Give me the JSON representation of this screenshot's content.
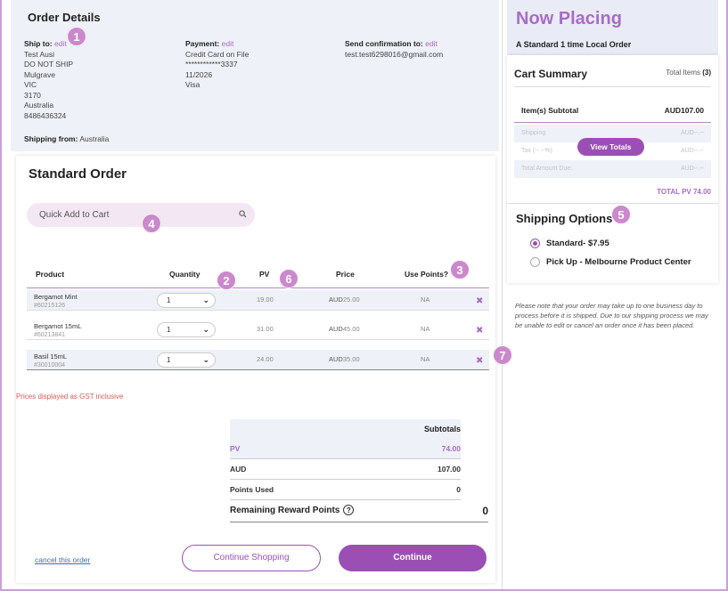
{
  "order_details": {
    "title": "Order Details",
    "ship_to_label": "Ship to:",
    "ship_to_edit": "edit",
    "ship_to_lines": [
      "Test Ausi",
      "DO NOT SHIP",
      "Mulgrave",
      "VIC",
      "3170",
      "Australia",
      "8486436324"
    ],
    "payment_label": "Payment:",
    "payment_edit": "edit",
    "payment_lines": [
      "Credit Card on File",
      "************3337",
      "11/2026",
      "Visa"
    ],
    "confirm_label": "Send confirmation to:",
    "confirm_edit": "edit",
    "confirm_email": "test.test6298016@gmail.com",
    "shipping_from_label": "Shipping from:",
    "shipping_from_value": "Australia"
  },
  "standard_order": {
    "title": "Standard Order",
    "quick_add_placeholder": "Quick Add to Cart",
    "headers": {
      "product": "Product",
      "quantity": "Quantity",
      "pv": "PV",
      "price": "Price",
      "use_points": "Use Points?"
    },
    "rows": [
      {
        "name": "Bergamot Mint",
        "sku": "#60215126",
        "qty": "1",
        "pv": "19.00",
        "currency": "AUD",
        "price": "25.00",
        "points": "NA"
      },
      {
        "name": "Bergamot 15mL",
        "sku": "#60213841",
        "qty": "1",
        "pv": "31.00",
        "currency": "AUD",
        "price": "45.00",
        "points": "NA"
      },
      {
        "name": "Basil 15mL",
        "sku": "#30010004",
        "qty": "1",
        "pv": "24.00",
        "currency": "AUD",
        "price": "35.00",
        "points": "NA"
      }
    ],
    "gst_note": "Prices displayed as GST inclusive",
    "subtotals": {
      "title": "Subtotals",
      "pv_label": "PV",
      "pv_value": "74.00",
      "aud_label": "AUD",
      "aud_value": "107.00",
      "points_label": "Points Used",
      "points_value": "0"
    },
    "remaining_label": "Remaining Reward Points",
    "remaining_value": "0",
    "help_glyph": "?",
    "cancel_link": "cancel this order",
    "continue_shopping": "Continue Shopping",
    "continue": "Continue",
    "remove_glyph": "✖",
    "chevron_glyph": "⌄"
  },
  "now_placing": {
    "title": "Now Placing",
    "subtitle": "A Standard 1 time Local Order"
  },
  "cart_summary": {
    "title": "Cart Summary",
    "total_items_label": "Total Items",
    "total_items_value": "(3)",
    "subtotal_label": "Item(s) Subtotal",
    "subtotal_value": "AUD107.00",
    "shipping_label": "Shipping",
    "shipping_value": "AUD--.--",
    "tax_label": "Tax (--.--%)",
    "tax_value": "AUD--.--",
    "total_label": "Total Amount Due:",
    "total_value": "AUD--.--",
    "view_totals": "View Totals",
    "total_pv": "TOTAL PV 74.00"
  },
  "shipping_options": {
    "title": "Shipping Options",
    "options": [
      {
        "label": "Standard- $7.95",
        "selected": true
      },
      {
        "label": "Pick Up - Melbourne Product Center",
        "selected": false
      }
    ]
  },
  "note": "Please note that your order may take up to one business day to process before it is shipped. Due to our shipping process we may be unable to edit or cancel an order once it has been placed.",
  "badges": [
    "1",
    "2",
    "3",
    "4",
    "5",
    "6",
    "7"
  ],
  "colors": {
    "accent": "#9b4fb5",
    "badge": "#cc88cc",
    "panel": "#eef1f7",
    "error": "#e05a5a"
  }
}
